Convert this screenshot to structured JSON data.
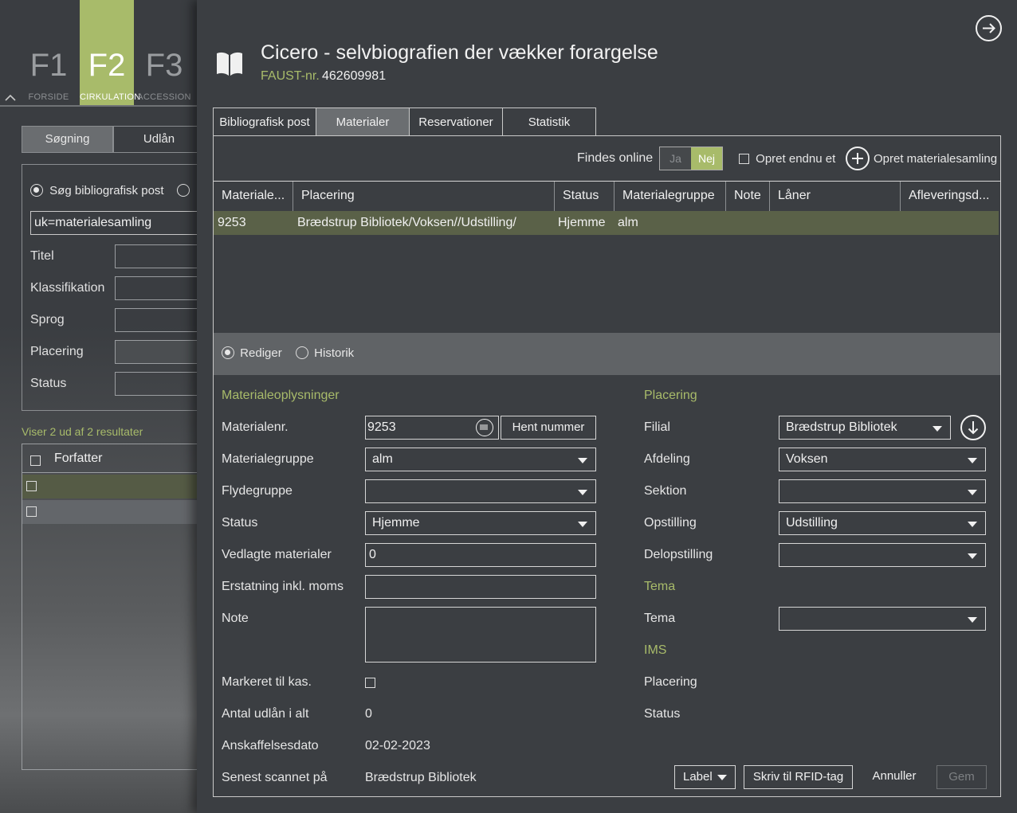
{
  "fkeys": [
    {
      "key": "F1",
      "label": "FORSIDE"
    },
    {
      "key": "F2",
      "label": "CIRKULATION"
    },
    {
      "key": "F3",
      "label": "ACCESSION"
    }
  ],
  "left": {
    "tabs": [
      "Søgning",
      "Udlån"
    ],
    "radio_label": "Søg bibliografisk post",
    "query": "uk=materialesamling",
    "fields": [
      "Titel",
      "Klassifikation",
      "Sprog",
      "Placering",
      "Status"
    ],
    "result_text": "Viser 2 ud af 2 resultater",
    "col_header": "Forfatter"
  },
  "modal": {
    "title": "Cicero - selvbiografien der vækker forargelse",
    "faust_label": "FAUST-nr.",
    "faust_value": "462609981",
    "tabs": [
      "Bibliografisk post",
      "Materialer",
      "Reservationer",
      "Statistik"
    ],
    "toolbar": {
      "findes_online": "Findes online",
      "ja": "Ja",
      "nej": "Nej",
      "opret_endnu": "Opret endnu et",
      "opret_samling": "Opret materialesamling"
    },
    "grid": {
      "headers": [
        "Materiale...",
        "Placering",
        "Status",
        "Materialegruppe",
        "Note",
        "Låner",
        "Afleveringsd..."
      ],
      "row": [
        "9253",
        "Brædstrup Bibliotek/Voksen//Udstilling/",
        "Hjemme",
        "alm",
        "",
        "",
        ""
      ]
    },
    "modes": {
      "rediger": "Rediger",
      "historik": "Historik"
    },
    "form": {
      "section_left": "Materialeoplysninger",
      "materialenr_label": "Materialenr.",
      "materialenr_value": "9253",
      "hent_nummer": "Hent nummer",
      "materialegruppe_label": "Materialegruppe",
      "materialegruppe_value": "alm",
      "flydegruppe_label": "Flydegruppe",
      "flydegruppe_value": "",
      "status_label": "Status",
      "status_value": "Hjemme",
      "vedlagte_label": "Vedlagte materialer",
      "vedlagte_value": "0",
      "erstatning_label": "Erstatning inkl. moms",
      "erstatning_value": "",
      "note_label": "Note",
      "note_value": "",
      "markeret_label": "Markeret til kas.",
      "antal_label": "Antal udlån i alt",
      "antal_value": "0",
      "anskaffelse_label": "Anskaffelsesdato",
      "anskaffelse_value": "02-02-2023",
      "senest_label": "Senest scannet på",
      "senest_value": "Brædstrup Bibliotek",
      "section_placering": "Placering",
      "filial_label": "Filial",
      "filial_value": "Brædstrup Bibliotek",
      "afdeling_label": "Afdeling",
      "afdeling_value": "Voksen",
      "sektion_label": "Sektion",
      "sektion_value": "",
      "opstilling_label": "Opstilling",
      "opstilling_value": "Udstilling",
      "delopstilling_label": "Delopstilling",
      "delopstilling_value": "",
      "section_tema": "Tema",
      "tema_label": "Tema",
      "tema_value": "",
      "section_ims": "IMS",
      "ims_placering_label": "Placering",
      "ims_status_label": "Status"
    },
    "footer": {
      "label_btn": "Label",
      "rfid_btn": "Skriv til RFID-tag",
      "annuller": "Annuller",
      "gem": "Gem"
    }
  },
  "colors": {
    "accent": "#a8bb6a",
    "row_selected": "#5a6148",
    "panel": "#3b3e42"
  }
}
